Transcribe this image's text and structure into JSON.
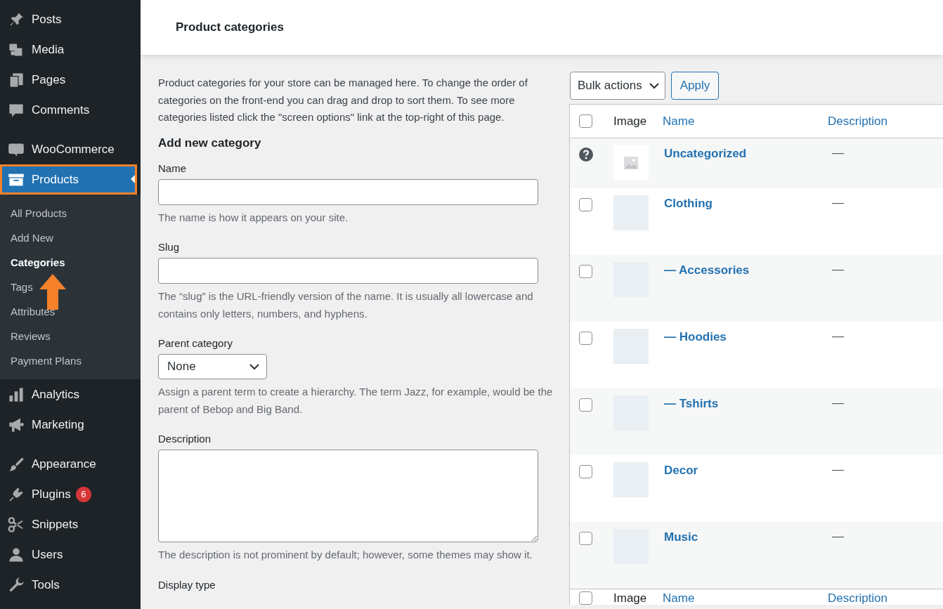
{
  "sidebar": {
    "sections": [
      [
        {
          "label": "Posts",
          "selected": false,
          "highlighted": false
        },
        {
          "label": "Media",
          "selected": false,
          "highlighted": false
        },
        {
          "label": "Pages",
          "selected": false,
          "highlighted": false
        },
        {
          "label": "Comments",
          "selected": false,
          "highlighted": false
        }
      ],
      [
        {
          "label": "WooCommerce",
          "selected": false,
          "highlighted": false
        },
        {
          "label": "Products",
          "selected": true,
          "highlighted": true,
          "expanded": true,
          "children": [
            {
              "label": "All Products",
              "selected": false
            },
            {
              "label": "Add New",
              "selected": false
            },
            {
              "label": "Categories",
              "selected": true
            },
            {
              "label": "Tags",
              "selected": false
            },
            {
              "label": "Attributes",
              "selected": false
            },
            {
              "label": "Reviews",
              "selected": false
            },
            {
              "label": "Payment Plans",
              "selected": false
            }
          ]
        },
        {
          "label": "Analytics",
          "selected": false,
          "highlighted": false
        },
        {
          "label": "Marketing",
          "selected": false,
          "highlighted": false
        }
      ],
      [
        {
          "label": "Appearance",
          "selected": false,
          "highlighted": false
        },
        {
          "label": "Plugins",
          "selected": false,
          "highlighted": false,
          "badge": "6"
        },
        {
          "label": "Snippets",
          "selected": false,
          "highlighted": false
        },
        {
          "label": "Users",
          "selected": false,
          "highlighted": false
        },
        {
          "label": "Tools",
          "selected": false,
          "highlighted": false
        }
      ]
    ]
  },
  "header": {
    "title": "Product categories"
  },
  "form": {
    "intro": "Product categories for your store can be managed here. To change the order of categories on the front-end you can drag and drop to sort them. To see more categories listed click the \"screen options\" link at the top-right of this page.",
    "heading": "Add new category",
    "fields": [
      {
        "kind": "text",
        "label": "Name",
        "hint": "The name is how it appears on your site."
      },
      {
        "kind": "text",
        "label": "Slug",
        "hint": "The “slug” is the URL-friendly version of the name. It is usually all lowercase and contains only letters, numbers, and hyphens."
      },
      {
        "kind": "select",
        "label": "Parent category",
        "value": "None",
        "hint": "Assign a parent term to create a hierarchy. The term Jazz, for example, would be the parent of Bebop and Big Band."
      },
      {
        "kind": "textarea",
        "label": "Description",
        "hint": "The description is not prominent by default; however, some themes may show it."
      },
      {
        "kind": "label",
        "label": "Display type"
      }
    ]
  },
  "table": {
    "bulk_action": "Bulk actions",
    "apply": "Apply",
    "select_all_checked": false,
    "columns": [
      {
        "label": "Image",
        "sortable": false
      },
      {
        "label": "Name",
        "sortable": true
      },
      {
        "label": "Description",
        "sortable": true
      }
    ],
    "rows": [
      {
        "kind": "default",
        "name": "Uncategorized",
        "description": "—"
      },
      {
        "kind": "category",
        "checked": false,
        "name": "Clothing",
        "description": "—"
      },
      {
        "kind": "category",
        "checked": false,
        "name": "— Accessories",
        "description": "—"
      },
      {
        "kind": "category",
        "checked": false,
        "name": "— Hoodies",
        "description": "—"
      },
      {
        "kind": "category",
        "checked": false,
        "name": "— Tshirts",
        "description": "—"
      },
      {
        "kind": "category",
        "checked": false,
        "name": "Decor",
        "description": "—"
      },
      {
        "kind": "category",
        "checked": false,
        "name": "Music",
        "description": "—"
      }
    ],
    "footer_columns": [
      {
        "label": "Image",
        "sortable": false
      },
      {
        "label": "Name",
        "sortable": true
      },
      {
        "label": "Description",
        "sortable": true
      }
    ]
  }
}
